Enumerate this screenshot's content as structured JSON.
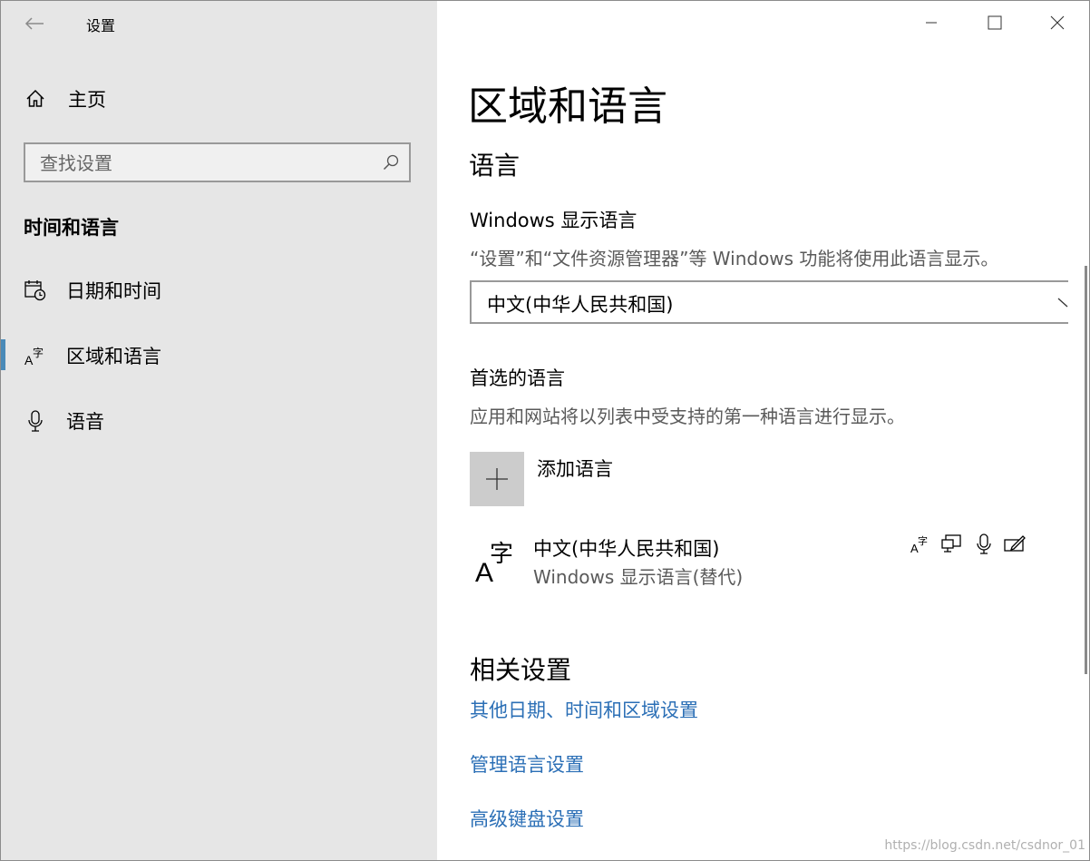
{
  "window": {
    "app_title": "设置",
    "controls": {
      "minimize": "minimize-icon",
      "maximize": "maximize-icon",
      "close": "close-icon"
    }
  },
  "sidebar": {
    "home_label": "主页",
    "search": {
      "placeholder": "查找设置",
      "value": ""
    },
    "section_title": "时间和语言",
    "items": [
      {
        "label": "日期和时间",
        "icon": "calendar-clock-icon",
        "active": false
      },
      {
        "label": "区域和语言",
        "icon": "language-icon",
        "active": true
      },
      {
        "label": "语音",
        "icon": "microphone-icon",
        "active": false
      }
    ]
  },
  "main": {
    "title": "区域和语言",
    "language_heading": "语言",
    "display_language": {
      "label": "Windows 显示语言",
      "description": "“设置”和“文件资源管理器”等 Windows 功能将使用此语言显示。",
      "selected": "中文(中华人民共和国)"
    },
    "preferred": {
      "heading": "首选的语言",
      "description": "应用和网站将以列表中受支持的第一种语言进行显示。",
      "add_label": "添加语言",
      "languages": [
        {
          "name": "中文(中华人民共和国)",
          "sub": "Windows 显示语言(替代)",
          "features": [
            "language-pack-icon",
            "display-icon",
            "speech-icon",
            "handwriting-icon"
          ]
        }
      ]
    },
    "related": {
      "heading": "相关设置",
      "links": [
        "其他日期、时间和区域设置",
        "管理语言设置",
        "高级键盘设置"
      ]
    }
  },
  "colors": {
    "accent": "#4a8ab8",
    "link": "#2b6fb6",
    "sidebar_bg": "#e6e6e6"
  },
  "watermark": "https://blog.csdn.net/csdnor_01"
}
